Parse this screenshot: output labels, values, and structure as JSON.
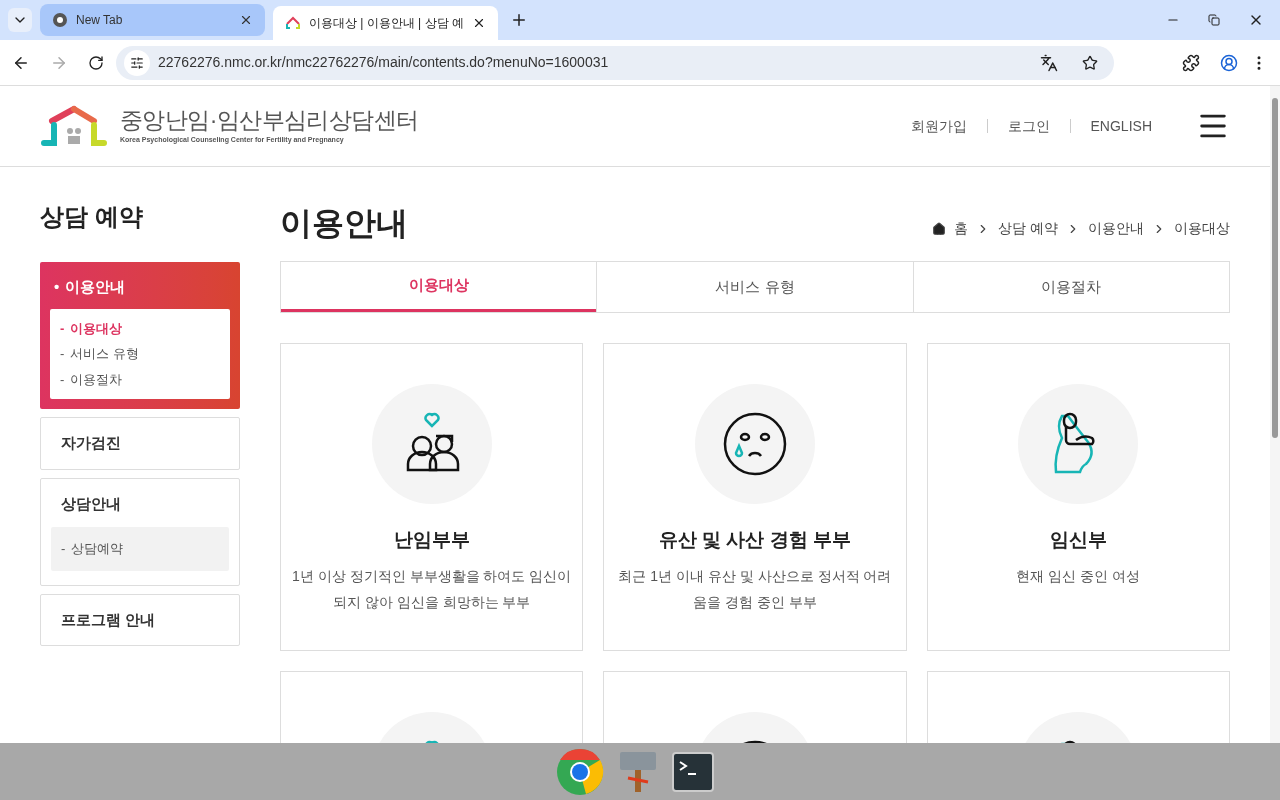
{
  "browser": {
    "tabs": [
      {
        "title": "New Tab",
        "selected": false
      },
      {
        "title": "이용대상 | 이용안내 | 상담 예",
        "selected": true
      }
    ],
    "url": "22762276.nmc.or.kr/nmc22762276/main/contents.do?menuNo=1600031"
  },
  "header": {
    "logo_title": "중앙난임·임산부심리상담센터",
    "logo_subtitle": "Korea Psychological Counseling Center for Fertility and Pregnancy",
    "links": [
      "회원가입",
      "로그인",
      "ENGLISH"
    ]
  },
  "sidebar": {
    "title": "상담 예약",
    "groups": [
      {
        "label": "이용안내",
        "bullet": "•",
        "selected": true,
        "children": [
          {
            "marker": "-",
            "label": "이용대상",
            "selected": true
          },
          {
            "marker": "-",
            "label": "서비스 유형",
            "selected": false
          },
          {
            "marker": "-",
            "label": "이용절차",
            "selected": false
          }
        ]
      },
      {
        "label": "자가검진",
        "selected": false
      },
      {
        "label": "상담안내",
        "selected": false,
        "children": [
          {
            "marker": "-",
            "label": "상담예약",
            "selected": false
          }
        ]
      },
      {
        "label": "프로그램 안내",
        "selected": false
      }
    ]
  },
  "main": {
    "title": "이용안내",
    "breadcrumb": [
      "홈",
      "상담 예약",
      "이용안내",
      "이용대상"
    ],
    "tabs": [
      {
        "label": "이용대상",
        "selected": true
      },
      {
        "label": "서비스 유형",
        "selected": false
      },
      {
        "label": "이용절차",
        "selected": false
      }
    ],
    "cards": [
      {
        "kind": "full",
        "title": "난임부부",
        "desc": "1년 이상 정기적인 부부생활을 하여도 임신이 되지 않아 임신을 희망하는 부부"
      },
      {
        "kind": "full",
        "title": "유산 및 사산 경험 부부",
        "desc": "최근 1년 이내 유산 및 사산으로 정서적 어려움을 경험 중인 부부"
      },
      {
        "kind": "full",
        "title": "임신부",
        "desc": "현재 임신 중인 여성"
      },
      {
        "kind": "cut"
      },
      {
        "kind": "cut"
      },
      {
        "kind": "cut"
      }
    ]
  }
}
